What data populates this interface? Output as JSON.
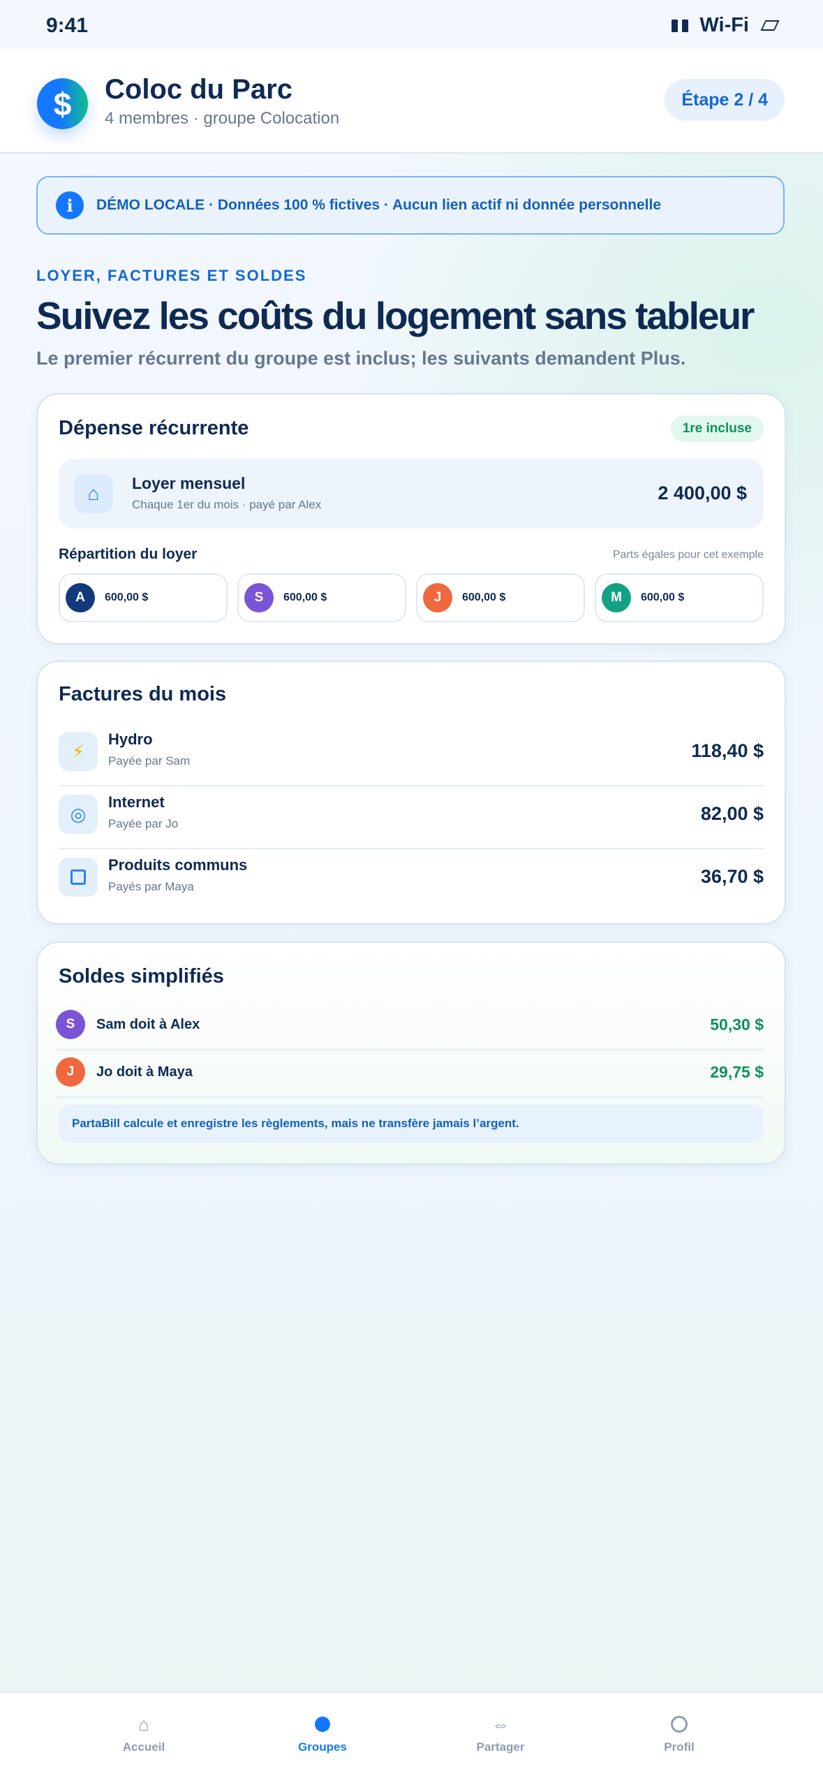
{
  "status_bar": {
    "time": "9:41",
    "network": "Wi-Fi"
  },
  "header": {
    "logo_symbol": "$",
    "title": "Coloc du Parc",
    "subtitle": "4 membres · groupe Colocation",
    "step": "Étape 2 / 4"
  },
  "banner": {
    "text": "DÉMO LOCALE · Données 100 % fictives · Aucun lien actif ni donnée personnelle"
  },
  "hero": {
    "eyebrow": "LOYER, FACTURES ET SOLDES",
    "title": "Suivez les coûts du logement sans tableur",
    "subtitle": "Le premier récurrent du groupe est inclus; les suivants demandent Plus."
  },
  "recurring": {
    "title": "Dépense récurrente",
    "badge": "1re incluse",
    "rent_icon": "home-icon",
    "rent_name": "Loyer mensuel",
    "rent_meta": "Chaque 1er du mois · payé par Alex",
    "rent_amount": "2 400,00 $",
    "split_label": "Répartition du loyer",
    "split_note": "Parts égales pour cet exemple",
    "members": [
      {
        "initial": "A",
        "amount": "600,00 $",
        "color": "#123a7a"
      },
      {
        "initial": "S",
        "amount": "600,00 $",
        "color": "#7b54d6"
      },
      {
        "initial": "J",
        "amount": "600,00 $",
        "color": "#f0683e"
      },
      {
        "initial": "M",
        "amount": "600,00 $",
        "color": "#12a283"
      }
    ]
  },
  "bills": {
    "title": "Factures du mois",
    "items": [
      {
        "icon": "bolt-icon",
        "name": "Hydro",
        "payer": "Payée par Sam",
        "amount": "118,40 $"
      },
      {
        "icon": "wifi-icon",
        "name": "Internet",
        "payer": "Payée par Jo",
        "amount": "82,00 $"
      },
      {
        "icon": "box-icon",
        "name": "Produits communs",
        "payer": "Payés par Maya",
        "amount": "36,70 $"
      }
    ]
  },
  "balances": {
    "title": "Soldes simplifiés",
    "items": [
      {
        "initial": "S",
        "text": "Sam doit à Alex",
        "amount": "50,30 $",
        "color": "#7b54d6"
      },
      {
        "initial": "J",
        "text": "Jo doit à Maya",
        "amount": "29,75 $",
        "color": "#f0683e"
      }
    ],
    "note": "PartaBill calcule et enregistre les règlements, mais ne transfère jamais l’argent."
  },
  "nav": {
    "items": [
      {
        "label": "Accueil",
        "icon": "home-icon",
        "active": false
      },
      {
        "label": "Groupes",
        "icon": "groups-dot-icon",
        "active": true
      },
      {
        "label": "Partager",
        "icon": "share-arrows-icon",
        "active": false
      },
      {
        "label": "Profil",
        "icon": "profile-circle-icon",
        "active": false
      }
    ]
  },
  "colors": {
    "accent": "#1477ff",
    "positive": "#10905e",
    "text": "#0f2a52",
    "muted": "#66778f"
  }
}
